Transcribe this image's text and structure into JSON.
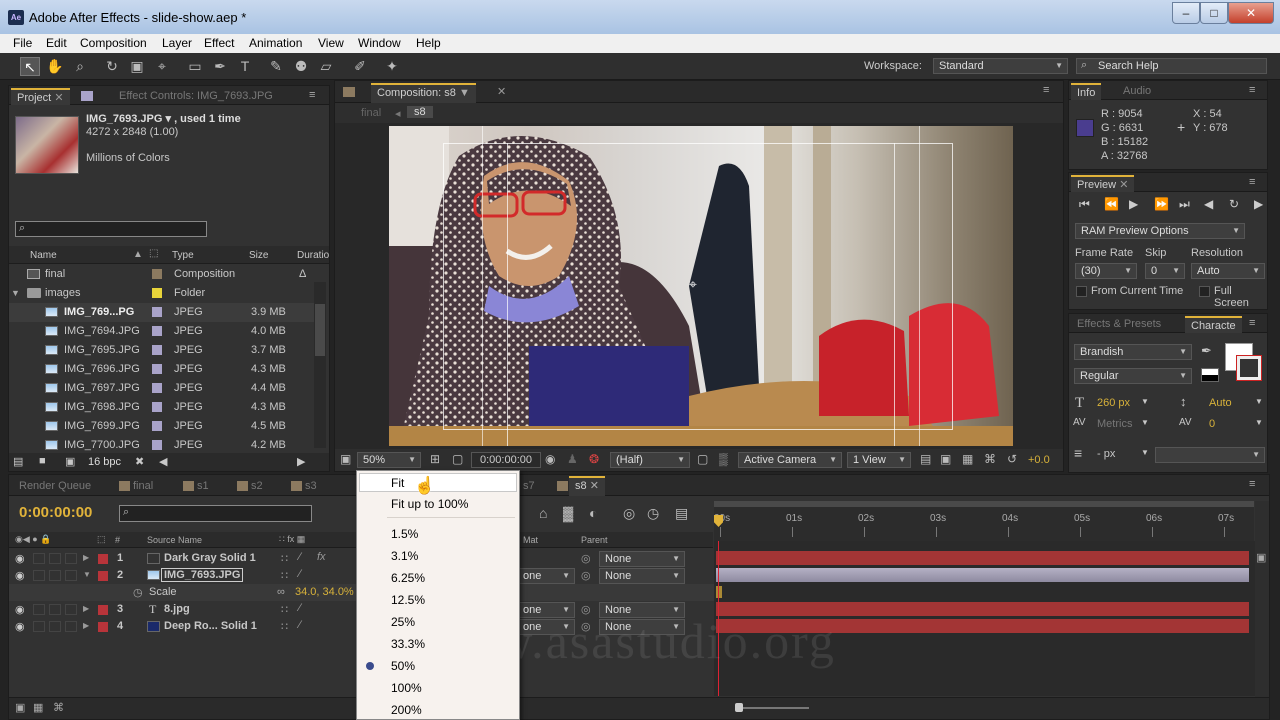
{
  "app": {
    "title": "Adobe After Effects - slide-show.aep *",
    "icon_text": "Ae",
    "window_buttons": [
      "minimize-icon",
      "maximize-icon",
      "close-icon"
    ]
  },
  "menu": [
    "File",
    "Edit",
    "Composition",
    "Layer",
    "Effect",
    "Animation",
    "View",
    "Window",
    "Help"
  ],
  "toolbar": {
    "workspace_label": "Workspace:",
    "workspace_value": "Standard",
    "search_placeholder": "Search Help"
  },
  "project": {
    "tab_project": "Project",
    "tab_effects": "Effect Controls: IMG_7693.JPG",
    "selected_name": "IMG_7693.JPG ▾ , used 1 time",
    "selected_dims": "4272 x 2848 (1.00)",
    "selected_colors": "Millions of Colors",
    "headers": {
      "name": "Name",
      "type": "Type",
      "size": "Size",
      "duration": "Duratio"
    },
    "rows": [
      {
        "name": "final",
        "type": "Composition",
        "size": "",
        "dur": "Δ",
        "color": "#8c7a60",
        "kind": "comp",
        "indent": 0,
        "sel": false
      },
      {
        "name": "images",
        "type": "Folder",
        "size": "",
        "dur": "",
        "color": "#e8d43a",
        "kind": "folder",
        "indent": 0,
        "sel": false
      },
      {
        "name": "IMG_769...PG",
        "type": "JPEG",
        "size": "3.9 MB",
        "dur": "",
        "color": "#a9a3c9",
        "kind": "img",
        "indent": 1,
        "sel": true
      },
      {
        "name": "IMG_7694.JPG",
        "type": "JPEG",
        "size": "4.0 MB",
        "dur": "",
        "color": "#a9a3c9",
        "kind": "img",
        "indent": 1,
        "sel": false
      },
      {
        "name": "IMG_7695.JPG",
        "type": "JPEG",
        "size": "3.7 MB",
        "dur": "",
        "color": "#a9a3c9",
        "kind": "img",
        "indent": 1,
        "sel": false
      },
      {
        "name": "IMG_7696.JPG",
        "type": "JPEG",
        "size": "4.3 MB",
        "dur": "",
        "color": "#a9a3c9",
        "kind": "img",
        "indent": 1,
        "sel": false
      },
      {
        "name": "IMG_7697.JPG",
        "type": "JPEG",
        "size": "4.4 MB",
        "dur": "",
        "color": "#a9a3c9",
        "kind": "img",
        "indent": 1,
        "sel": false
      },
      {
        "name": "IMG_7698.JPG",
        "type": "JPEG",
        "size": "4.3 MB",
        "dur": "",
        "color": "#a9a3c9",
        "kind": "img",
        "indent": 1,
        "sel": false
      },
      {
        "name": "IMG_7699.JPG",
        "type": "JPEG",
        "size": "4.5 MB",
        "dur": "",
        "color": "#a9a3c9",
        "kind": "img",
        "indent": 1,
        "sel": false
      },
      {
        "name": "IMG_7700.JPG",
        "type": "JPEG",
        "size": "4.2 MB",
        "dur": "",
        "color": "#a9a3c9",
        "kind": "img",
        "indent": 1,
        "sel": false
      }
    ],
    "bpc": "16 bpc"
  },
  "composition": {
    "tab": "Composition: s8",
    "crumb_final": "final",
    "crumb_s8": "s8",
    "zoom": "50%",
    "timecode": "0:00:00:00",
    "resolution": "(Half)",
    "camera": "Active Camera",
    "view": "1 View",
    "exposure": "+0.0"
  },
  "info": {
    "tab_info": "Info",
    "tab_audio": "Audio",
    "r": "R : 9054",
    "g": "G : 6631",
    "b": "B : 15182",
    "a": "A : 32768",
    "x": "X : 54",
    "y": "Y : 678",
    "swatch": "#4a3d8f"
  },
  "preview": {
    "tab": "Preview",
    "ram_options": "RAM Preview Options",
    "frame_rate_label": "Frame Rate",
    "skip_label": "Skip",
    "resolution_label": "Resolution",
    "frame_rate": "(30)",
    "skip": "0",
    "resolution": "Auto",
    "from_current": "From Current Time",
    "full_screen": "Full Screen"
  },
  "character": {
    "tab_effects": "Effects & Presets",
    "tab_char": "Characte",
    "font": "Brandish",
    "style": "Regular",
    "size": "260 px",
    "leading": "Auto",
    "kerning": "Metrics",
    "tracking": "0",
    "stroke": "- px"
  },
  "timeline": {
    "tabs": [
      "Render Queue",
      "final",
      "s1",
      "s2",
      "s3",
      "s7",
      "s8"
    ],
    "timecode": "0:00:00:00",
    "headers": {
      "source": "Source Name",
      "mat": "Mat",
      "parent": "Parent"
    },
    "rows": [
      {
        "num": "1",
        "name": "Dark Gray Solid 1",
        "color": "#b8343a",
        "swatch": "#333333",
        "parent": "None",
        "expanded": false,
        "icon": "solid"
      },
      {
        "num": "2",
        "name": "IMG_7693.JPG",
        "color": "#b8343a",
        "swatch": "img",
        "parent": "None",
        "expanded": true,
        "icon": "img"
      },
      {
        "num": "3",
        "name": "8.jpg",
        "color": "#b8343a",
        "swatch": "text",
        "parent": "None",
        "expanded": false,
        "icon": "text"
      },
      {
        "num": "4",
        "name": "Deep Ro... Solid 1",
        "color": "#b8343a",
        "swatch": "#1a2a6a",
        "parent": "None",
        "expanded": false,
        "icon": "solid"
      }
    ],
    "scale_label": "Scale",
    "scale_value": "34.0, 34.0%",
    "mat_value": "one",
    "ruler": [
      "00s",
      "01s",
      "02s",
      "03s",
      "04s",
      "05s",
      "06s",
      "07s"
    ]
  },
  "zoom_menu": {
    "items": [
      "Fit",
      "Fit up to 100%",
      "1.5%",
      "3.1%",
      "6.25%",
      "12.5%",
      "25%",
      "33.3%",
      "50%",
      "100%",
      "200%"
    ],
    "highlighted": "Fit",
    "checked": "50%"
  },
  "watermark": "www.asastudio.org"
}
